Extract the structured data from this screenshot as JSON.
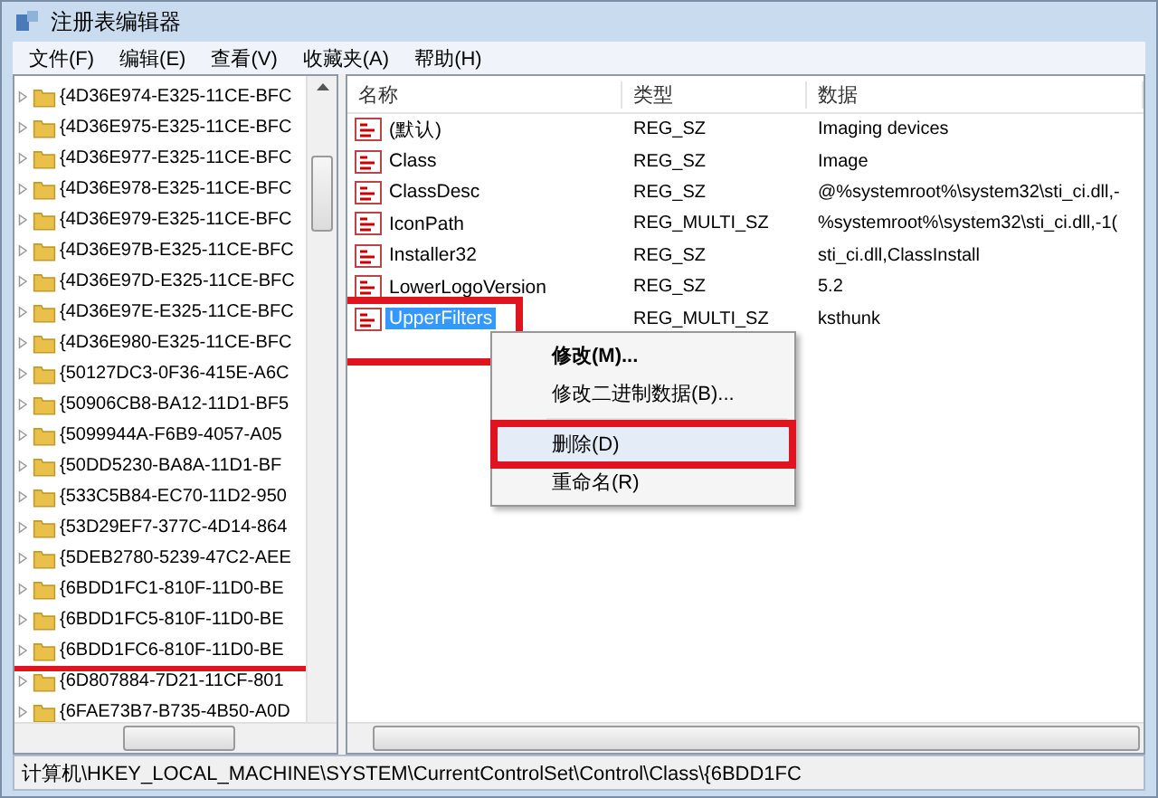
{
  "window": {
    "title": "注册表编辑器"
  },
  "menu": [
    "文件(F)",
    "编辑(E)",
    "查看(V)",
    "收藏夹(A)",
    "帮助(H)"
  ],
  "tree": {
    "items": [
      {
        "label": "{4D36E974-E325-11CE-BFC",
        "expanded": false,
        "marked": false
      },
      {
        "label": "{4D36E975-E325-11CE-BFC",
        "expanded": false,
        "marked": false
      },
      {
        "label": "{4D36E977-E325-11CE-BFC",
        "expanded": false,
        "marked": false
      },
      {
        "label": "{4D36E978-E325-11CE-BFC",
        "expanded": false,
        "marked": false
      },
      {
        "label": "{4D36E979-E325-11CE-BFC",
        "expanded": false,
        "marked": false
      },
      {
        "label": "{4D36E97B-E325-11CE-BFC",
        "expanded": false,
        "marked": false
      },
      {
        "label": "{4D36E97D-E325-11CE-BFC",
        "expanded": false,
        "marked": false
      },
      {
        "label": "{4D36E97E-E325-11CE-BFC",
        "expanded": false,
        "marked": false
      },
      {
        "label": "{4D36E980-E325-11CE-BFC",
        "expanded": false,
        "marked": false
      },
      {
        "label": "{50127DC3-0F36-415E-A6C",
        "expanded": false,
        "marked": false
      },
      {
        "label": "{50906CB8-BA12-11D1-BF5",
        "expanded": false,
        "marked": false
      },
      {
        "label": "{5099944A-F6B9-4057-A05",
        "expanded": false,
        "marked": false
      },
      {
        "label": "{50DD5230-BA8A-11D1-BF",
        "expanded": false,
        "marked": false
      },
      {
        "label": "{533C5B84-EC70-11D2-950",
        "expanded": false,
        "marked": false
      },
      {
        "label": "{53D29EF7-377C-4D14-864",
        "expanded": false,
        "marked": false
      },
      {
        "label": "{5DEB2780-5239-47C2-AEE",
        "expanded": false,
        "marked": false
      },
      {
        "label": "{6BDD1FC1-810F-11D0-BE",
        "expanded": false,
        "marked": false
      },
      {
        "label": "{6BDD1FC5-810F-11D0-BE",
        "expanded": false,
        "marked": false
      },
      {
        "label": "{6BDD1FC6-810F-11D0-BE",
        "expanded": false,
        "marked": true
      },
      {
        "label": "{6D807884-7D21-11CF-801",
        "expanded": false,
        "marked": false
      },
      {
        "label": "{6FAE73B7-B735-4B50-A0D",
        "expanded": false,
        "marked": false
      }
    ]
  },
  "values": {
    "columns": [
      "名称",
      "类型",
      "数据"
    ],
    "rows": [
      {
        "name": "(默认)",
        "type": "REG_SZ",
        "data": "Imaging devices",
        "selected": false,
        "marked": false
      },
      {
        "name": "Class",
        "type": "REG_SZ",
        "data": "Image",
        "selected": false,
        "marked": false
      },
      {
        "name": "ClassDesc",
        "type": "REG_SZ",
        "data": "@%systemroot%\\system32\\sti_ci.dll,-",
        "selected": false,
        "marked": false
      },
      {
        "name": "IconPath",
        "type": "REG_MULTI_SZ",
        "data": "%systemroot%\\system32\\sti_ci.dll,-1(",
        "selected": false,
        "marked": false
      },
      {
        "name": "Installer32",
        "type": "REG_SZ",
        "data": "sti_ci.dll,ClassInstall",
        "selected": false,
        "marked": false
      },
      {
        "name": "LowerLogoVersion",
        "type": "REG_SZ",
        "data": "5.2",
        "selected": false,
        "marked": false
      },
      {
        "name": "UpperFilters",
        "type": "REG_MULTI_SZ",
        "data": "ksthunk",
        "selected": true,
        "marked": true
      }
    ]
  },
  "context_menu": {
    "items": [
      {
        "kind": "item",
        "label": "修改(M)...",
        "default": true,
        "selected": false,
        "marked": false
      },
      {
        "kind": "item",
        "label": "修改二进制数据(B)...",
        "default": false,
        "selected": false,
        "marked": false
      },
      {
        "kind": "separator"
      },
      {
        "kind": "item",
        "label": "删除(D)",
        "default": false,
        "selected": true,
        "marked": true
      },
      {
        "kind": "item",
        "label": "重命名(R)",
        "default": false,
        "selected": false,
        "marked": false
      }
    ]
  },
  "status_bar": "计算机\\HKEY_LOCAL_MACHINE\\SYSTEM\\CurrentControlSet\\Control\\Class\\{6BDD1FC"
}
